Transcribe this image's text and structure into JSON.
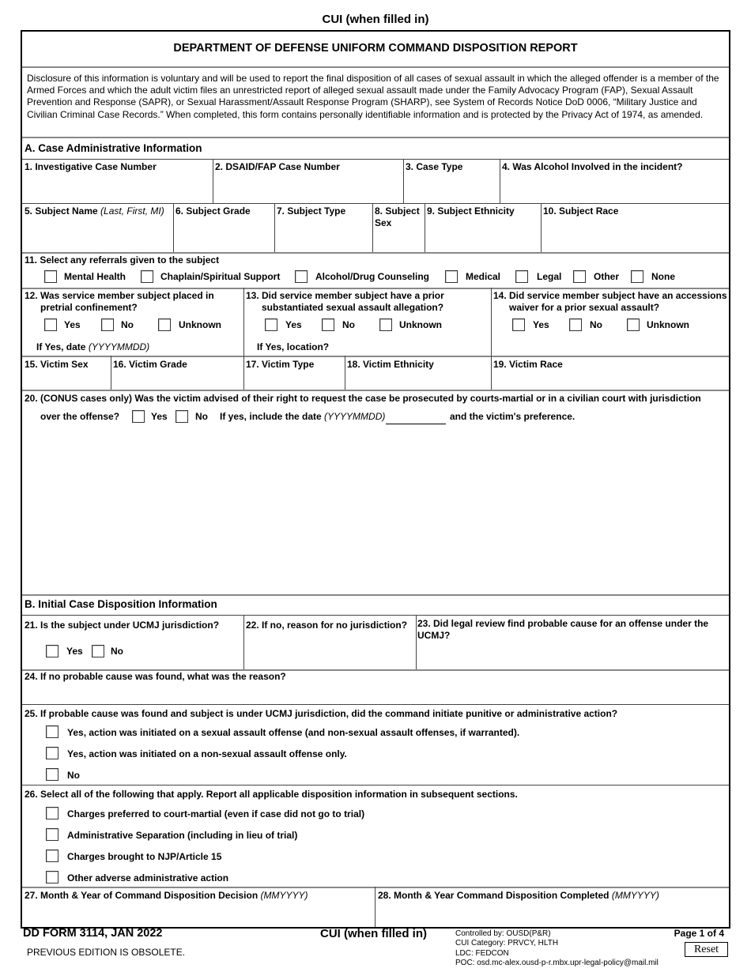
{
  "header": {
    "cui_top": "CUI (when filled in)",
    "title": "DEPARTMENT OF DEFENSE UNIFORM COMMAND DISPOSITION REPORT",
    "disclosure": "Disclosure of this information is voluntary and will be used to report the final disposition of all cases of sexual assault in which the alleged offender is a member of the Armed Forces and which the adult victim files an unrestricted report of alleged sexual assault made under the Family Advocacy Program (FAP), Sexual Assault Prevention and Response (SAPR), or Sexual Harassment/Assault Response Program (SHARP), see System of Records Notice DoD 0006, “Military Justice and Civilian Criminal Case Records.”  When completed, this form contains personally identifiable information and is protected by the Privacy Act of 1974, as amended."
  },
  "section_a": {
    "title": "A. Case Administrative Information",
    "f1": "1. Investigative Case Number",
    "f2": "2. DSAID/FAP Case Number",
    "f3": "3. Case Type",
    "f4": "4. Was Alcohol Involved in the incident?",
    "f5": "5. Subject Name",
    "f5_hint": "(Last, First, MI)",
    "f6": "6. Subject Grade",
    "f7": "7. Subject Type",
    "f8": "8. Subject Sex",
    "f9": "9. Subject Ethnicity",
    "f10": "10. Subject Race",
    "f11": "11. Select any referrals given to the subject",
    "f11_options": [
      "Mental Health",
      "Chaplain/Spiritual Support",
      "Alcohol/Drug Counseling",
      "Medical",
      "Legal",
      "Other",
      "None"
    ],
    "f12": "12. Was service member subject placed in pretrial confinement?",
    "f13": "13. Did service member subject have a prior substantiated sexual assault allegation?",
    "f14": "14. Did service member subject have an accessions waiver for a prior sexual assault?",
    "yes_no_unknown": [
      "Yes",
      "No",
      "Unknown"
    ],
    "f12_date": "If Yes, date",
    "f12_date_hint": "(YYYYMMDD)",
    "f13_location": "If Yes, location?",
    "f15": "15. Victim Sex",
    "f16": "16. Victim Grade",
    "f17": "17. Victim Type",
    "f18": "18. Victim Ethnicity",
    "f19": "19. Victim Race",
    "f20_line1": "20. (CONUS cases only) Was the victim advised of their right to request the case be prosecuted by courts-martial or in a civilian court with jurisdiction",
    "f20_line2": "over the offense?",
    "f20_yes": "Yes",
    "f20_no": "No",
    "f20_date": "If yes, include the date",
    "f20_date_hint": "(YYYYMMDD)",
    "f20_pref": "and the victim's preference."
  },
  "section_b": {
    "title": "B. Initial Case Disposition Information",
    "f21": "21. Is the subject under UCMJ jurisdiction?",
    "f21_yes": "Yes",
    "f21_no": "No",
    "f22": "22. If no, reason for no jurisdiction?",
    "f23": "23. Did legal review find probable cause for an offense under the UCMJ?",
    "f24": "24. If no probable cause was found, what was the reason?",
    "f25": "25. If probable cause was found and subject is under UCMJ jurisdiction, did the command initiate punitive or administrative action?",
    "f25_options": [
      "Yes, action was initiated on a sexual assault offense (and non-sexual assault offenses, if warranted).",
      "Yes, action was initiated on a non-sexual assault offense only.",
      "No"
    ],
    "f26": "26. Select all of the following that apply. Report all applicable disposition information in subsequent sections.",
    "f26_options": [
      "Charges preferred to court-martial (even if case did not go to trial)",
      "Administrative Separation (including in lieu of trial)",
      "Charges brought to NJP/Article 15",
      "Other adverse administrative action"
    ],
    "f27": "27. Month & Year of Command Disposition Decision",
    "f27_hint": "(MMYYYY)",
    "f28": "28. Month & Year Command Disposition Completed",
    "f28_hint": "(MMYYYY)"
  },
  "footer": {
    "form_id": "DD FORM 3114, JAN 2022",
    "obsolete": "PREVIOUS EDITION IS OBSOLETE.",
    "cui": "CUI (when filled in)",
    "controlled_by": "Controlled by: OUSD(P&R)",
    "cui_category": "CUI Category: PRVCY, HLTH",
    "ldc": "LDC: FEDCON",
    "poc": "POC: osd.mc-alex.ousd-p-r.mbx.upr-legal-policy@mail.mil",
    "page": "Page 1 of 4",
    "reset_label": "Reset"
  }
}
